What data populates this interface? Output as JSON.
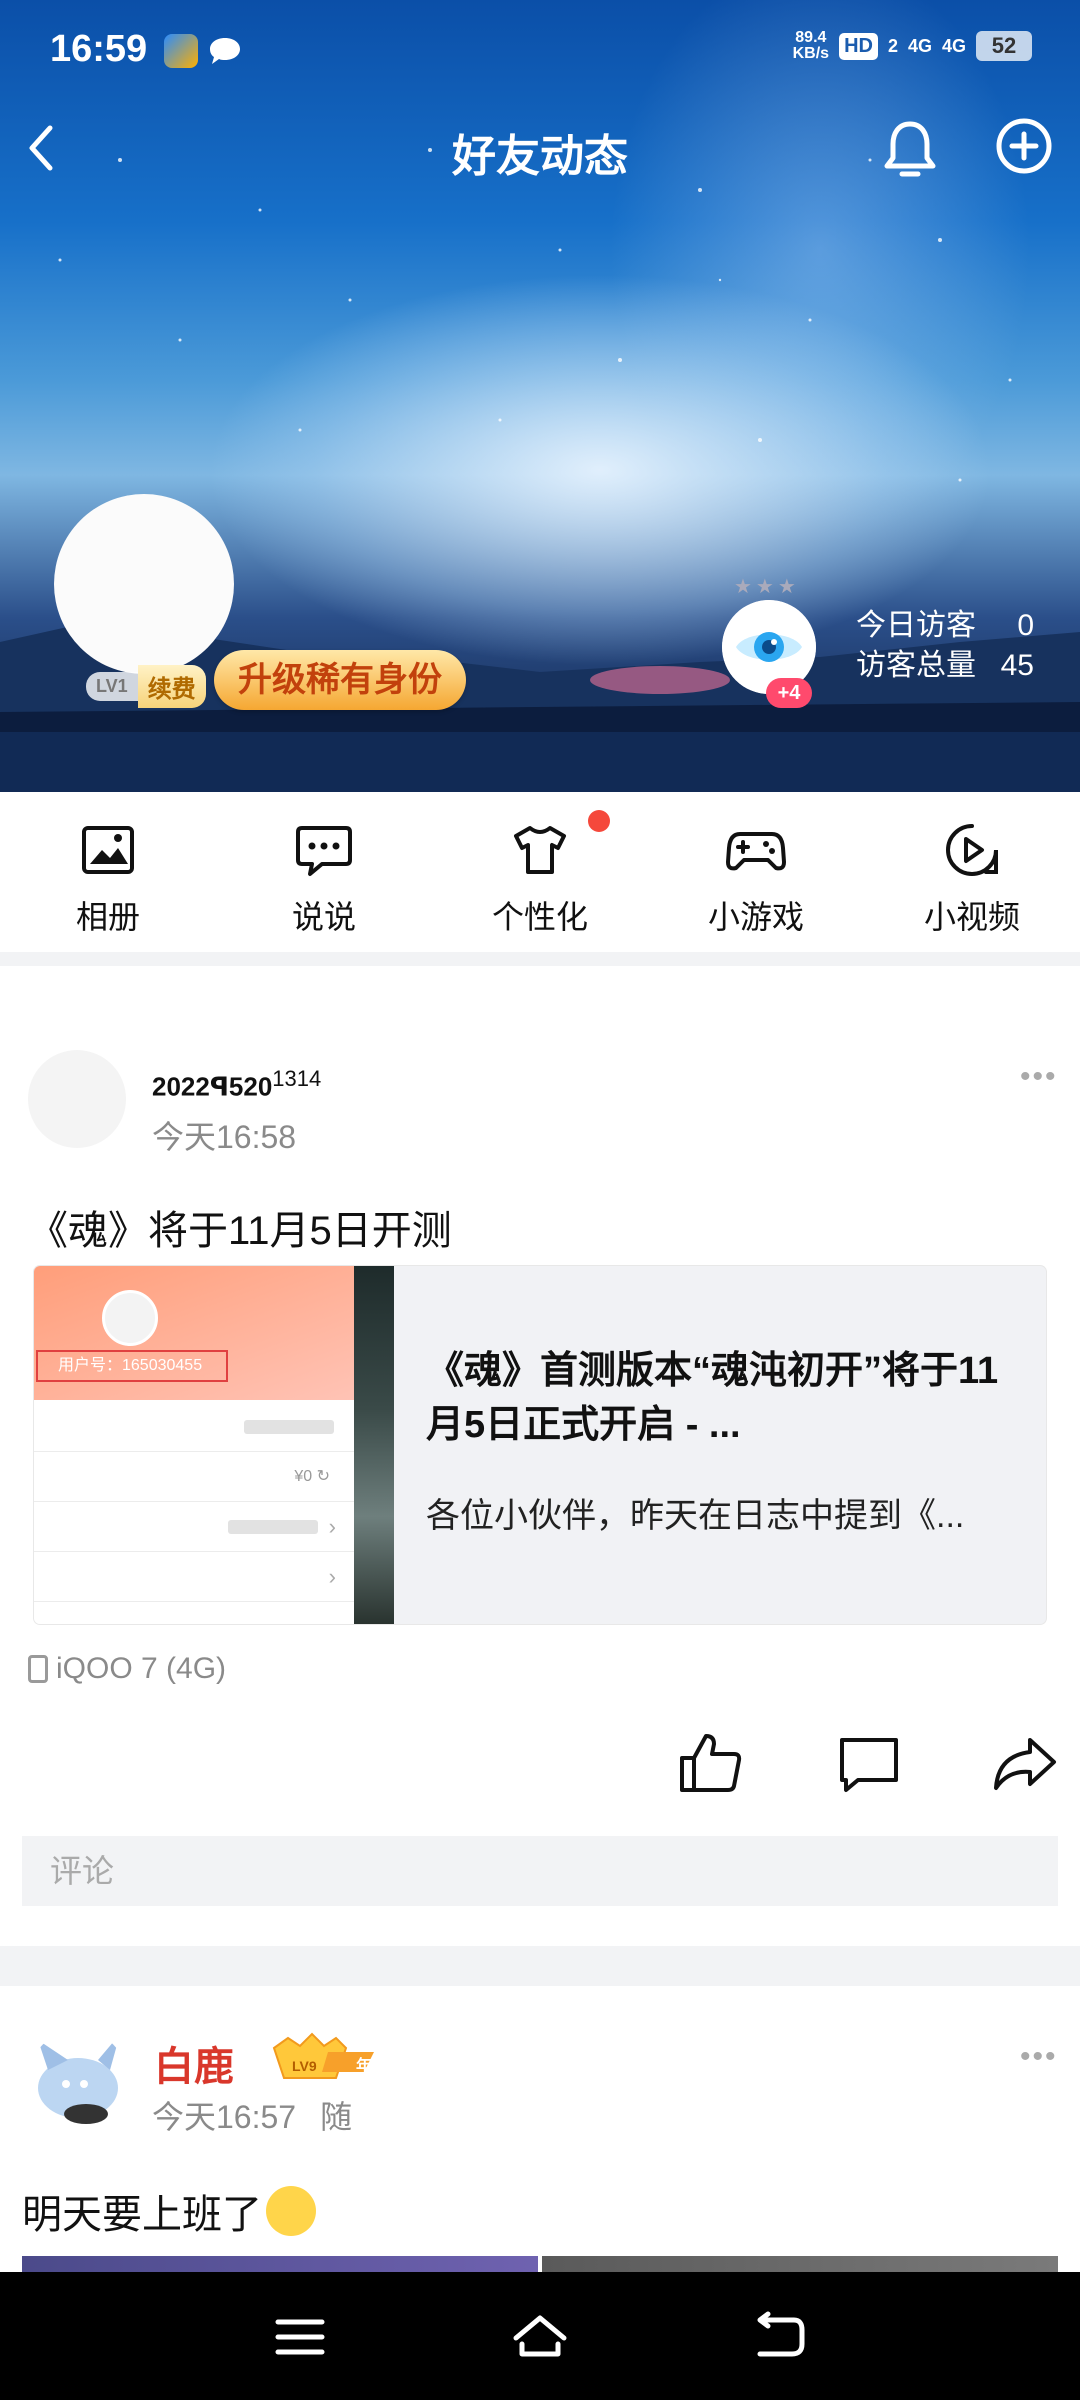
{
  "status_bar": {
    "time": "16:59",
    "net_speed_value": "89.4",
    "net_speed_unit": "KB/s",
    "hd_label": "HD",
    "hd_sub": "2",
    "sig1": "4G",
    "sig2": "4G",
    "battery": "52"
  },
  "header": {
    "title": "好友动态",
    "lv_label": "LV1",
    "renew_label": "续费",
    "upgrade_label": "升级稀有身份",
    "eye_plus": "+4",
    "eye_stars": "★★★",
    "today_visitors_label": "今日访客",
    "today_visitors_value": "0",
    "total_visitors_label": "访客总量",
    "total_visitors_value": "45"
  },
  "quick_nav": [
    {
      "label": "相册",
      "icon": "photo-album-icon"
    },
    {
      "label": "说说",
      "icon": "talk-bubble-icon"
    },
    {
      "label": "个性化",
      "icon": "tshirt-icon"
    },
    {
      "label": "小游戏",
      "icon": "gamepad-icon"
    },
    {
      "label": "小视频",
      "icon": "play-video-icon"
    }
  ],
  "post1": {
    "author": "2022ꟼ520",
    "author_sup": "1314",
    "time": "今天16:58",
    "more": "•••",
    "text": "《魂》将于11月5日开测",
    "card": {
      "thumb_uid": "用户号：165030455",
      "thumb_price": "¥0 ↻",
      "title": "《魂》首测版本“魂沌初开”将于11月5日正式开启 - ...",
      "desc": "各位小伙伴，昨天在日志中提到《..."
    },
    "device": "iQOO 7 (4G)",
    "comment_placeholder": "评论"
  },
  "post2": {
    "author": "白鹿",
    "vip_level": "LV9",
    "vip_year": "年",
    "time": "今天16:57",
    "tag": "随",
    "more": "•••",
    "text": "明天要上班了"
  },
  "colors": {
    "accent_red": "#f5483b",
    "name_red": "#d9372b",
    "upgrade_orange": "#f5a732"
  }
}
